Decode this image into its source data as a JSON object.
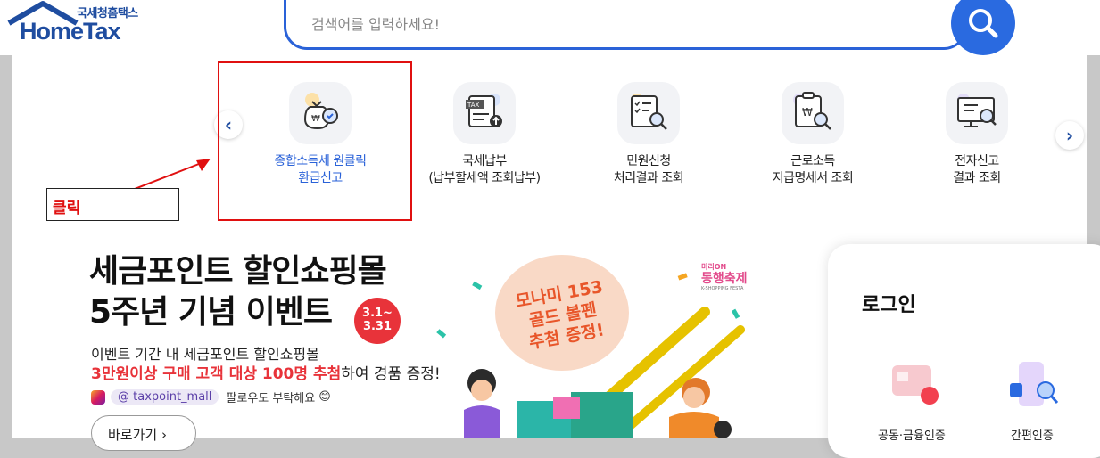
{
  "header": {
    "logo_small": "국세청홈택스",
    "logo_big": "HomeTax",
    "search_placeholder": "검색어를 입력하세요!"
  },
  "menu": {
    "items": [
      {
        "label_line1": "종합소득세 원클릭",
        "label_line2": "환급신고",
        "icon": "money-bag-search-icon"
      },
      {
        "label_line1": "국세납부",
        "label_line2": "(납부할세액 조회납부)",
        "icon": "tax-document-upload-icon"
      },
      {
        "label_line1": "민원신청",
        "label_line2": "처리결과 조회",
        "icon": "checklist-search-icon"
      },
      {
        "label_line1": "근로소득",
        "label_line2": "지급명세서 조회",
        "icon": "clipboard-won-search-icon"
      },
      {
        "label_line1": "전자신고",
        "label_line2": "결과 조회",
        "icon": "monitor-search-icon"
      }
    ]
  },
  "annotation": {
    "click_label": "클릭"
  },
  "banner": {
    "title_line1": "세금포인트 할인쇼핑몰",
    "title_line2": "5주년 기념 이벤트",
    "date_line1": "3.1~",
    "date_line2": "3.31",
    "line1": "이벤트 기간 내 세금포인트 할인쇼핑몰",
    "line2_highlight": "3만원이상 구매 고객 대상 100명 추첨",
    "line2_rest": "하여 경품 증정!",
    "insta_handle": "@ taxpoint_mall",
    "insta_note": "팔로우도 부탁해요",
    "go_button": "바로가기",
    "bubble_line1": "모나미 153",
    "bubble_line2": "골드 볼펜",
    "bubble_line3": "추첨 증정!",
    "festival_top": "미리ON",
    "festival_main": "동행축제",
    "festival_sub": "K-SHOPPING FESTA"
  },
  "login": {
    "title": "로그인",
    "option1": "공동·금융인증",
    "option2": "간편인증"
  },
  "colors": {
    "brand_blue": "#1f4da0",
    "search_blue": "#2a6ae0",
    "highlight_red": "#e01010"
  }
}
